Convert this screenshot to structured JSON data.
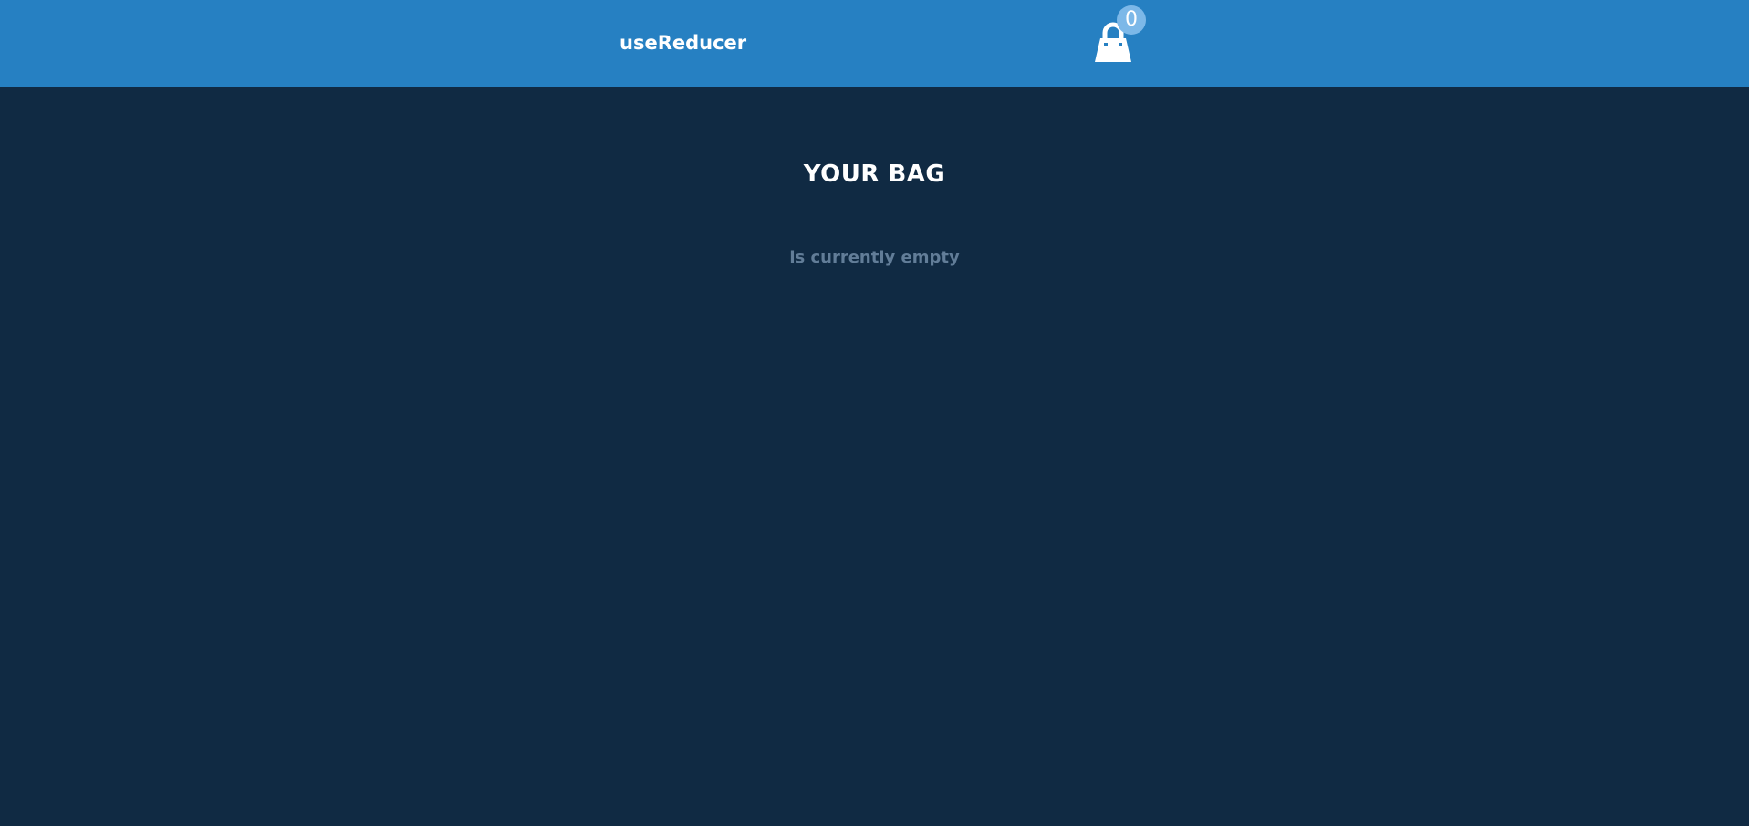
{
  "navbar": {
    "brand": "useReducer",
    "cart_icon": "shopping-bag-icon",
    "cart_count": "0"
  },
  "main": {
    "title": "YOUR BAG",
    "empty_message": "is currently empty"
  },
  "colors": {
    "navbar_bg": "#2680c2",
    "page_bg": "#102a43",
    "badge_bg": "#7cb8e8",
    "muted_text": "#627d98"
  }
}
